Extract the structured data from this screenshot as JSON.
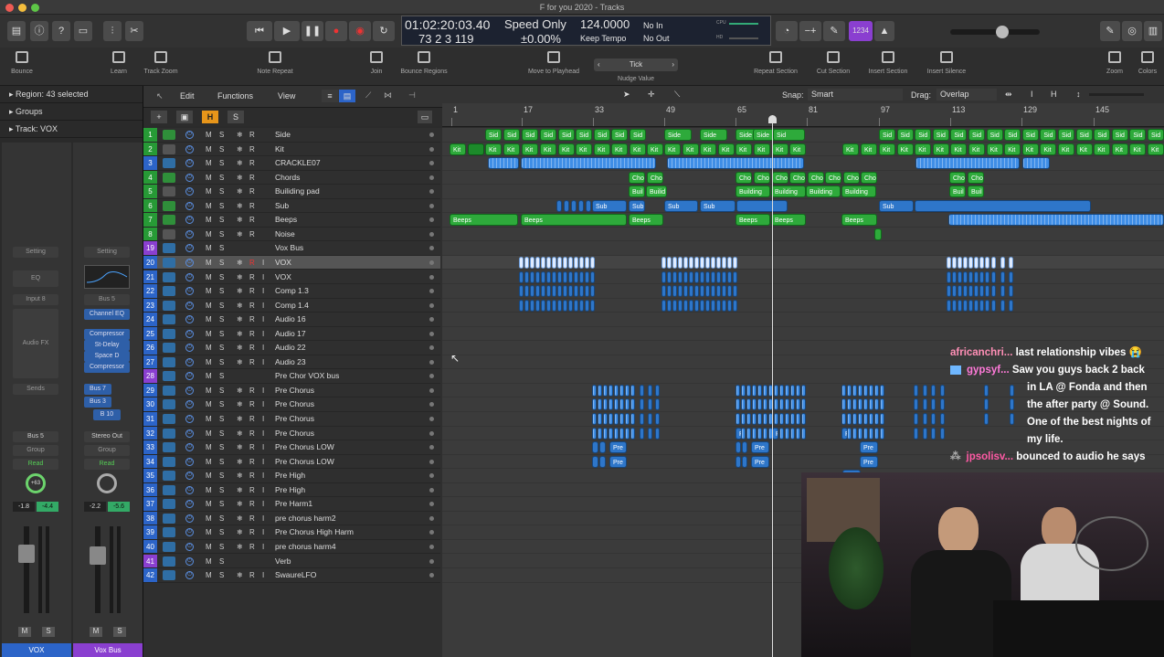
{
  "window": {
    "title": "F for you 2020 - Tracks"
  },
  "lcd": {
    "position": "01:02:20:03.40",
    "bars": "73  2  3  119",
    "mode_top": "Speed Only",
    "mode_val": "±0.00%",
    "tempo": "124.0000",
    "tempo_label": "Keep Tempo",
    "in": "No In",
    "out": "No Out",
    "cpu": "CPU",
    "hd": "HD",
    "count_btn": "1234"
  },
  "toolbar": {
    "bounce": "Bounce",
    "learn": "Learn",
    "track_zoom": "Track Zoom",
    "note_repeat": "Note Repeat",
    "join": "Join",
    "bounce_regions": "Bounce Regions",
    "move_to_playhead": "Move to Playhead",
    "nudge_value": "Nudge Value",
    "nudge_setting": "Tick",
    "repeat_section": "Repeat Section",
    "cut_section": "Cut Section",
    "insert_section": "Insert Section",
    "insert_silence": "Insert Silence",
    "zoom": "Zoom",
    "colors": "Colors"
  },
  "inspector": {
    "region": "Region: 43 selected",
    "groups": "Groups",
    "track_label": "Track:",
    "track_name": "VOX"
  },
  "strip1": {
    "setting": "Setting",
    "eq": "EQ",
    "input": "Input 8",
    "fx": "Audio FX",
    "sends": "Sends",
    "out": "Bus 5",
    "group": "Group",
    "read": "Read",
    "pan": "+63",
    "vol1": "-1.8",
    "vol2": "-4.4",
    "m": "M",
    "s": "S",
    "name": "VOX",
    "name_color": "#2c64c8"
  },
  "strip2": {
    "setting": "Setting",
    "input": "Bus 5",
    "plugins": [
      "Channel EQ",
      "Compressor",
      "St-Delay",
      "Space D",
      "Compressor"
    ],
    "sends": [
      "Bus 7",
      "Bus 3",
      "B 10"
    ],
    "out": "Stereo Out",
    "group": "Group",
    "read": "Read",
    "vol1": "-2.2",
    "vol2": "-5.6",
    "m": "M",
    "s": "S",
    "name": "Vox Bus",
    "name_color": "#8a3fd0"
  },
  "lemenu": {
    "edit": "Edit",
    "functions": "Functions",
    "view": "View",
    "snap_label": "Snap:",
    "snap": "Smart",
    "drag_label": "Drag:",
    "drag": "Overlap",
    "h": "H",
    "s": "S",
    "add": "+"
  },
  "tracks": [
    {
      "num": "1",
      "name": "Side",
      "color": "g"
    },
    {
      "num": "2",
      "name": "Kit",
      "color": "g"
    },
    {
      "num": "3",
      "name": "CRACKLE07",
      "color": "b"
    },
    {
      "num": "4",
      "name": "Chords",
      "color": "g"
    },
    {
      "num": "5",
      "name": "Builiding pad",
      "color": "g"
    },
    {
      "num": "6",
      "name": "Sub",
      "color": "g"
    },
    {
      "num": "7",
      "name": "Beeps",
      "color": "g"
    },
    {
      "num": "8",
      "name": "Noise",
      "color": "g"
    },
    {
      "num": "19",
      "name": "Vox Bus",
      "color": "p"
    },
    {
      "num": "20",
      "name": "VOX",
      "color": "b"
    },
    {
      "num": "21",
      "name": "VOX",
      "color": "b"
    },
    {
      "num": "22",
      "name": "Comp 1.3",
      "color": "b"
    },
    {
      "num": "23",
      "name": "Comp 1.4",
      "color": "b"
    },
    {
      "num": "24",
      "name": "Audio 16",
      "color": "b"
    },
    {
      "num": "25",
      "name": "Audio 17",
      "color": "b"
    },
    {
      "num": "26",
      "name": "Audio 22",
      "color": "b"
    },
    {
      "num": "27",
      "name": "Audio 23",
      "color": "b"
    },
    {
      "num": "28",
      "name": "Pre Chor VOX bus",
      "color": "p"
    },
    {
      "num": "29",
      "name": "Pre Chorus",
      "color": "b"
    },
    {
      "num": "30",
      "name": "Pre Chorus",
      "color": "b"
    },
    {
      "num": "31",
      "name": "Pre Chorus",
      "color": "b"
    },
    {
      "num": "32",
      "name": "Pre Chorus",
      "color": "b"
    },
    {
      "num": "33",
      "name": "Pre Chorus LOW",
      "color": "b"
    },
    {
      "num": "34",
      "name": "Pre Chorus LOW",
      "color": "b"
    },
    {
      "num": "35",
      "name": "Pre High",
      "color": "b"
    },
    {
      "num": "36",
      "name": "Pre High",
      "color": "b"
    },
    {
      "num": "37",
      "name": "Pre Harm1",
      "color": "b"
    },
    {
      "num": "38",
      "name": "pre chorus harm2",
      "color": "b"
    },
    {
      "num": "39",
      "name": "Pre Chorus High Harm",
      "color": "b"
    },
    {
      "num": "40",
      "name": "pre chorus harm4",
      "color": "b"
    },
    {
      "num": "41",
      "name": "Verb",
      "color": "p"
    },
    {
      "num": "42",
      "name": "SwaureLFO",
      "color": "b"
    }
  ],
  "ruler": [
    "1",
    "17",
    "33",
    "49",
    "65",
    "81",
    "97",
    "113",
    "129",
    "145"
  ],
  "region_labels": {
    "side": "Side",
    "sid": "Sid",
    "kit": "Kit",
    "cho": "Cho",
    "chords": "Chords",
    "buil": "Buil",
    "builid": "Builid",
    "building": "Building",
    "sub": "Sub",
    "beeps": "Beeps",
    "p": "P",
    "pre": "Pre"
  },
  "chat": [
    {
      "user": "africanchri...",
      "text": "last relationship vibes 😭",
      "color": "#ff8fb6"
    },
    {
      "user": "gypsyf...",
      "text": "Saw you guys back 2 back",
      "color": "#ff7ad9"
    },
    {
      "user": "",
      "text": "in LA @ Fonda and then",
      "color": ""
    },
    {
      "user": "",
      "text": "the after party @ Sound.",
      "color": ""
    },
    {
      "user": "",
      "text": "One of the best nights of",
      "color": ""
    },
    {
      "user": "",
      "text": "my life.",
      "color": ""
    },
    {
      "user": "jpsolisv...",
      "text": "bounced to audio he says",
      "color": "#ff5aa5"
    }
  ]
}
